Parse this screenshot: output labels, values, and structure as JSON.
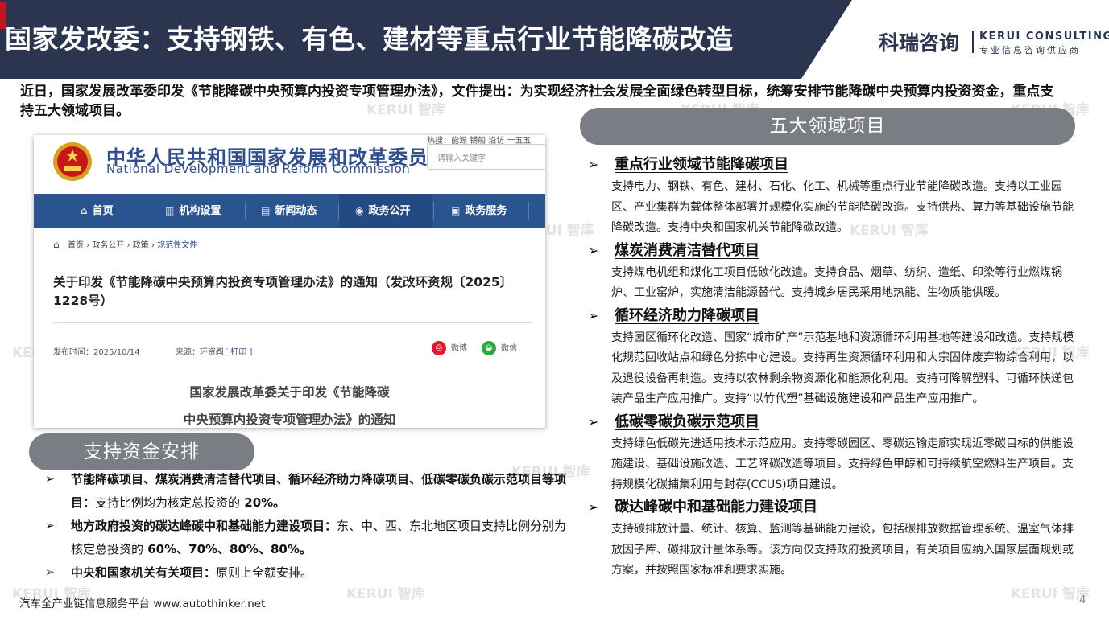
{
  "header": {
    "title": "国家发改委：支持钢铁、有色、建材等重点行业节能降碳改造",
    "logo_cn": "科瑞咨询",
    "logo_en": "KERUI CONSULTING",
    "logo_sub": "专业信息咨询供应商",
    "colors": {
      "bar": "#2b3550",
      "accent": "#c0161e"
    }
  },
  "intro": "近日，国家发展改革委印发《节能降碳中央预算内投资专项管理办法》，文件提出：为实现经济社会发展全面绿色转型目标，统筹安排节能降碳中央预算内投资资金，重点支持五大领域项目。",
  "watermark": "KERUI 智库",
  "screenshot": {
    "org_cn": "中华人民共和国国家发展和改革委员会",
    "org_en": "National Development and Reform Commission",
    "tags": "热搜：能源  铺船  沿访  十五五",
    "search_placeholder": "请输入关键字",
    "nav": [
      "首页",
      "机构设置",
      "新闻动态",
      "政务公开",
      "政务服务"
    ],
    "nav_icons": [
      "home-icon",
      "building-icon",
      "news-icon",
      "broadcast-icon",
      "service-icon"
    ],
    "breadcrumb": [
      "首页",
      "政务公开",
      "政策"
    ],
    "breadcrumb_current": "规范性文件",
    "doc_title": "关于印发《节能降碳中央预算内投资专项管理办法》的通知（发改环资规〔2025〕1228号）",
    "publish_time": "发布时间：2025/10/14",
    "source": "来源：环资司",
    "print": "[ 打印 ]",
    "share_weibo": "微博",
    "share_wechat": "微信",
    "body_line1": "国家发展改革委关于印发《节能降碳",
    "body_line2": "中央预算内投资专项管理办法》的通知"
  },
  "funding": {
    "pill": "支持资金安排",
    "items": [
      {
        "bold": "节能降碳项目、煤炭消费清洁替代项目、循环经济助力降碳项目、低碳零碳负碳示范项目等项目：",
        "normal": "支持比例均为核定总投资的",
        "tail": " 20%。"
      },
      {
        "bold": "地方政府投资的碳达峰碳中和基础能力建设项目：",
        "normal": "东、中、西、东北地区项目支持比例分别为核定总投资的",
        "tail": " 60%、70%、80%、80%。"
      },
      {
        "bold": "中央和国家机关有关项目：",
        "normal": "原则上全额安排。",
        "tail": ""
      }
    ]
  },
  "domains": {
    "pill": "五大领域项目",
    "sections": [
      {
        "title": "重点行业领域节能降碳项目",
        "body": "支持电力、钢铁、有色、建材、石化、化工、机械等重点行业节能降碳改造。支持以工业园区、产业集群为载体整体部署并规模化实施的节能降碳改造。支持供热、算力等基础设施节能降碳改造。支持中央和国家机关节能降碳改造。"
      },
      {
        "title": "煤炭消费清洁替代项目",
        "body": "支持煤电机组和煤化工项目低碳化改造。支持食品、烟草、纺织、造纸、印染等行业燃煤锅炉、工业窑炉，实施清洁能源替代。支持城乡居民采用地热能、生物质能供暖。"
      },
      {
        "title": "循环经济助力降碳项目",
        "body": "支持园区循环化改造、国家“城市矿产”示范基地和资源循环利用基地等建设和改造。支持规模化规范回收站点和绿色分拣中心建设。支持再生资源循环利用和大宗固体废弃物综合利用，以及退役设备再制造。支持以农林剩余物资源化和能源化利用。支持可降解塑料、可循环快递包装产品生产应用推广。支持“以竹代塑”基础设施建设和产品生产应用推广。"
      },
      {
        "title": "低碳零碳负碳示范项目",
        "body": "支持绿色低碳先进适用技术示范应用。支持零碳园区、零碳运输走廊实现近零碳目标的供能设施建设、基础设施改造、工艺降碳改造等项目。支持绿色甲醇和可持续航空燃料生产项目。支持规模化碳捕集利用与封存(CCUS)项目建设。"
      },
      {
        "title": "碳达峰碳中和基础能力建设项目",
        "body": "支持碳排放计量、统计、核算、监测等基础能力建设，包括碳排放数据管理系统、温室气体排放因子库、碳排放计量体系等。该方向仅支持政府投资项目，有关项目应纳入国家层面规划或方案，并按照国家标准和要求实施。"
      }
    ]
  },
  "footer": "汽车全产业链信息服务平台 www.autothinker.net",
  "page_number": "4"
}
